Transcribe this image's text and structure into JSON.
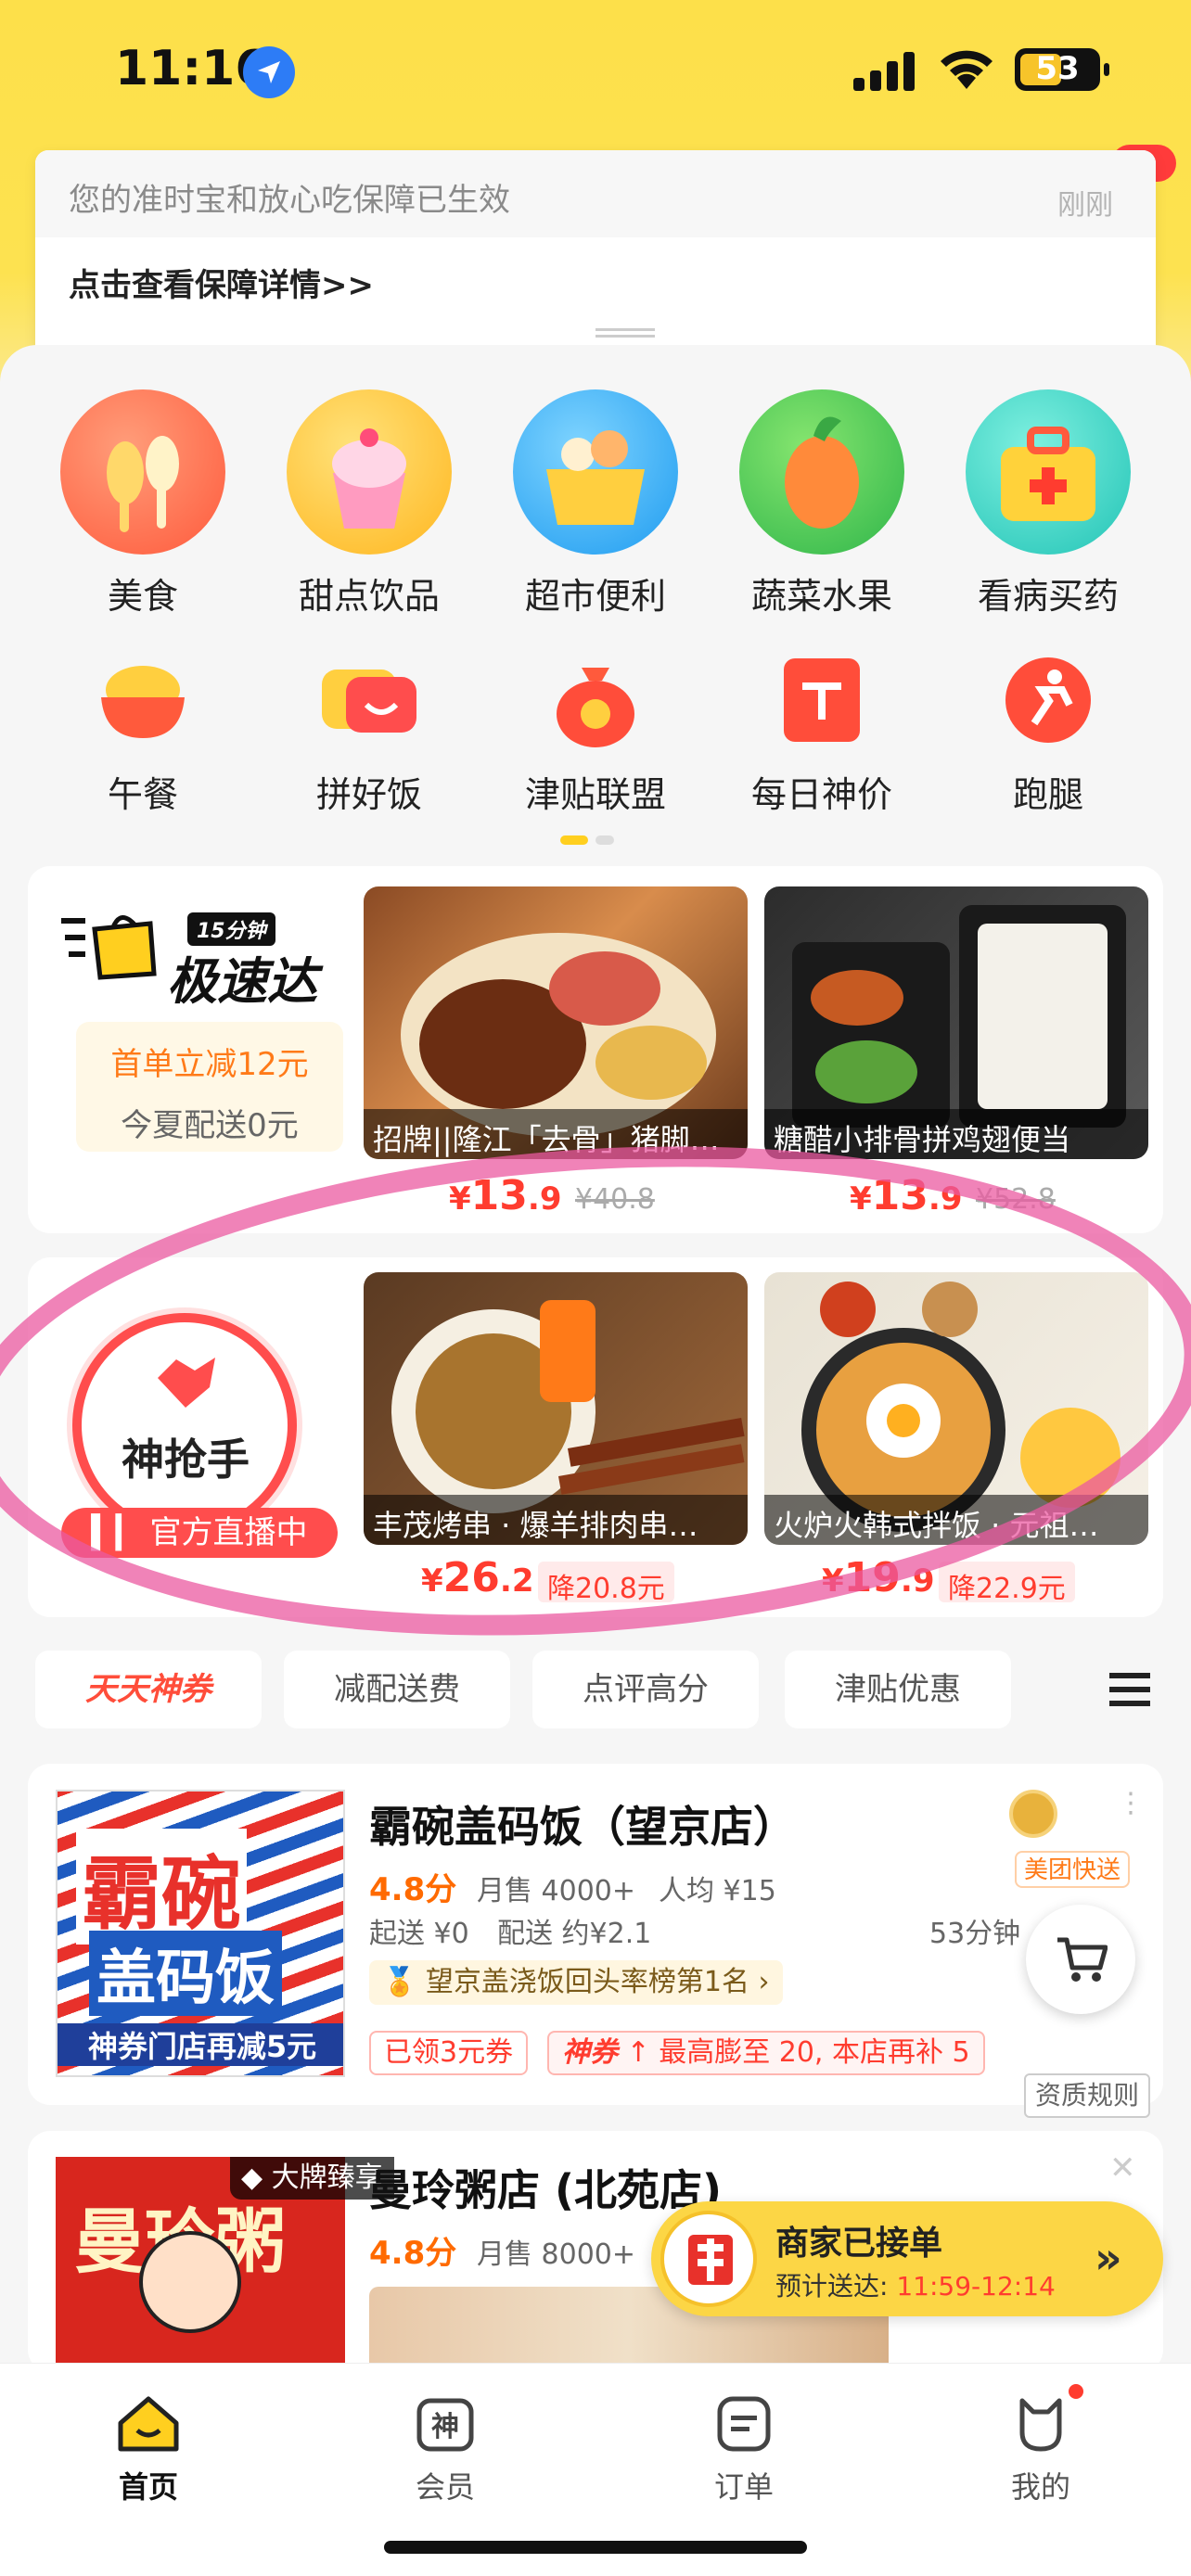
{
  "status_bar": {
    "time": "11:16",
    "battery": "53"
  },
  "notice": {
    "message": "您的准时宝和放心吃保障已生效",
    "time": "刚刚",
    "link": "点击查看保障详情>>"
  },
  "categories_main": [
    {
      "label": "美食",
      "icon": "food-icon",
      "color": "#ff7b5a"
    },
    {
      "label": "甜点饮品",
      "icon": "dessert-icon",
      "color": "#ffc63a"
    },
    {
      "label": "超市便利",
      "icon": "supermarket-icon",
      "color": "#46b8ff"
    },
    {
      "label": "蔬菜水果",
      "icon": "fruit-icon",
      "color": "#4fcf5a"
    },
    {
      "label": "看病买药",
      "icon": "medicine-icon",
      "color": "#3fd0c0"
    }
  ],
  "categories_secondary": [
    {
      "label": "午餐",
      "icon": "lunch-icon"
    },
    {
      "label": "拼好饭",
      "icon": "group-meal-icon"
    },
    {
      "label": "津贴联盟",
      "icon": "allowance-icon"
    },
    {
      "label": "每日神价",
      "icon": "daily-price-icon"
    },
    {
      "label": "跑腿",
      "icon": "errand-icon"
    }
  ],
  "express": {
    "badge": "15分钟",
    "title": "极速达",
    "promo_1": "首单立减12元",
    "promo_2": "今夏配送0元",
    "items": [
      {
        "name": "招牌||隆江「去骨」猪脚…",
        "price_symbol": "¥",
        "price_int": "13",
        "price_dec": ".9",
        "old_price": "¥40.8"
      },
      {
        "name": "糖醋小排骨拼鸡翅便当",
        "price_symbol": "¥",
        "price_int": "13",
        "price_dec": ".9",
        "old_price": "¥52.8"
      }
    ]
  },
  "flash": {
    "title": "神抢手",
    "live": "官方直播中",
    "items": [
      {
        "name": "丰茂烤串 · 爆羊排肉串…",
        "price_symbol": "¥",
        "price_int": "26",
        "price_dec": ".2",
        "cut": "降20.8元"
      },
      {
        "name": "火炉火韩式拌饭 · 元祖…",
        "price_symbol": "¥",
        "price_int": "19",
        "price_dec": ".9",
        "cut": "降22.9元"
      }
    ]
  },
  "filter_tabs": [
    "天天神券",
    "减配送费",
    "点评高分",
    "津贴优惠"
  ],
  "stores": [
    {
      "name": "霸碗盖码饭（望京店）",
      "rating": "4.8分",
      "monthly": "月售 4000+",
      "avg": "人均 ¥15",
      "min_order": "起送 ¥0",
      "delivery": "配送 约¥2.1",
      "time": "53分钟",
      "badge": "美团快送",
      "rank": "望京盖浇饭回头率榜第1名 ›",
      "coupon": "已领3元券",
      "super_coupon_tag": "神券",
      "super_coupon": "最高膨至 20, 本店再补 5",
      "logo_text_1": "霸碗",
      "logo_text_2": "盖码饭",
      "logo_banner": "神券门店再减5元",
      "qualification": "资质规则"
    },
    {
      "name": "曼玲粥店 (北苑店)",
      "rating": "4.8分",
      "monthly": "月售 8000+",
      "brand_tag": "大牌臻享",
      "logo_text": "曼玲粥"
    }
  ],
  "order_bar": {
    "title": "商家已接单",
    "eta_label": "预计送达:",
    "eta": "11:59-12:14"
  },
  "nav": [
    {
      "label": "首页",
      "icon": "home-icon",
      "active": true
    },
    {
      "label": "会员",
      "icon": "member-icon",
      "active": false
    },
    {
      "label": "订单",
      "icon": "order-icon",
      "active": false
    },
    {
      "label": "我的",
      "icon": "profile-icon",
      "active": false
    }
  ]
}
